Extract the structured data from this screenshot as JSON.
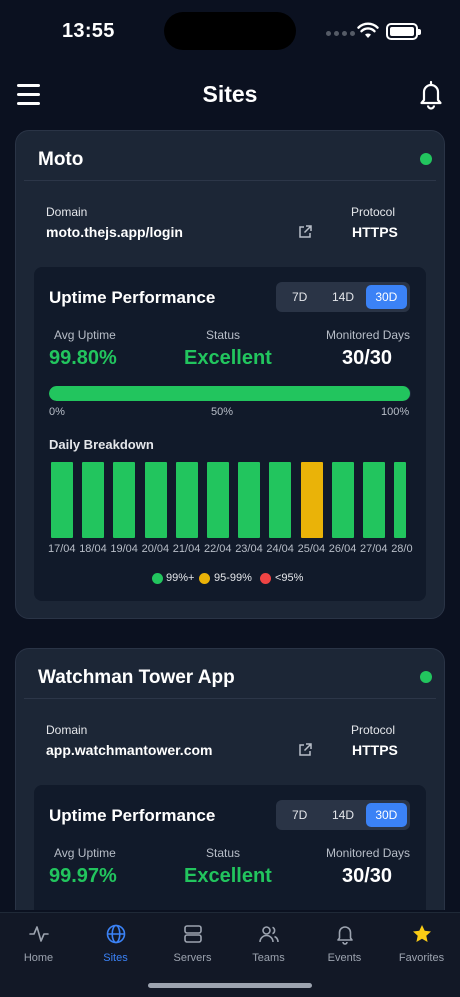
{
  "status_bar": {
    "time": "13:55"
  },
  "header": {
    "title": "Sites"
  },
  "labels": {
    "domain": "Domain",
    "protocol": "Protocol",
    "uptime_performance": "Uptime Performance",
    "avg_uptime": "Avg Uptime",
    "status": "Status",
    "monitored_days": "Monitored Days",
    "daily_breakdown": "Daily Breakdown",
    "scale": [
      "0%",
      "50%",
      "100%"
    ]
  },
  "range_options": [
    "7D",
    "14D",
    "30D"
  ],
  "selected_range": "30D",
  "colors": {
    "green": "#22c55e",
    "yellow": "#eab308",
    "red": "#ef4444",
    "accent": "#3b82f6"
  },
  "legend": [
    {
      "label": "99%+",
      "color": "#22c55e"
    },
    {
      "label": "95-99%",
      "color": "#eab308"
    },
    {
      "label": "<95%",
      "color": "#ef4444"
    }
  ],
  "sites": [
    {
      "name": "Moto",
      "online": true,
      "domain": "moto.thejs.app/login",
      "protocol": "HTTPS",
      "avg_uptime": "99.80%",
      "avg_uptime_fraction": 0.998,
      "status": "Excellent",
      "monitored_days": "30/30",
      "daily": [
        {
          "date": "17/04",
          "level": "green"
        },
        {
          "date": "18/04",
          "level": "green"
        },
        {
          "date": "19/04",
          "level": "green"
        },
        {
          "date": "20/04",
          "level": "green"
        },
        {
          "date": "21/04",
          "level": "green"
        },
        {
          "date": "22/04",
          "level": "green"
        },
        {
          "date": "23/04",
          "level": "green"
        },
        {
          "date": "24/04",
          "level": "green"
        },
        {
          "date": "25/04",
          "level": "yellow"
        },
        {
          "date": "26/04",
          "level": "green"
        },
        {
          "date": "27/04",
          "level": "green"
        },
        {
          "date": "28/0",
          "level": "green"
        }
      ]
    },
    {
      "name": "Watchman Tower App",
      "online": true,
      "domain": "app.watchmantower.com",
      "protocol": "HTTPS",
      "avg_uptime": "99.97%",
      "status": "Excellent",
      "monitored_days": "30/30"
    }
  ],
  "tabs": [
    {
      "label": "Home",
      "icon": "activity-icon"
    },
    {
      "label": "Sites",
      "icon": "globe-icon",
      "active": true
    },
    {
      "label": "Servers",
      "icon": "server-icon"
    },
    {
      "label": "Teams",
      "icon": "users-icon"
    },
    {
      "label": "Events",
      "icon": "bell-icon"
    },
    {
      "label": "Favorites",
      "icon": "star-icon"
    }
  ]
}
